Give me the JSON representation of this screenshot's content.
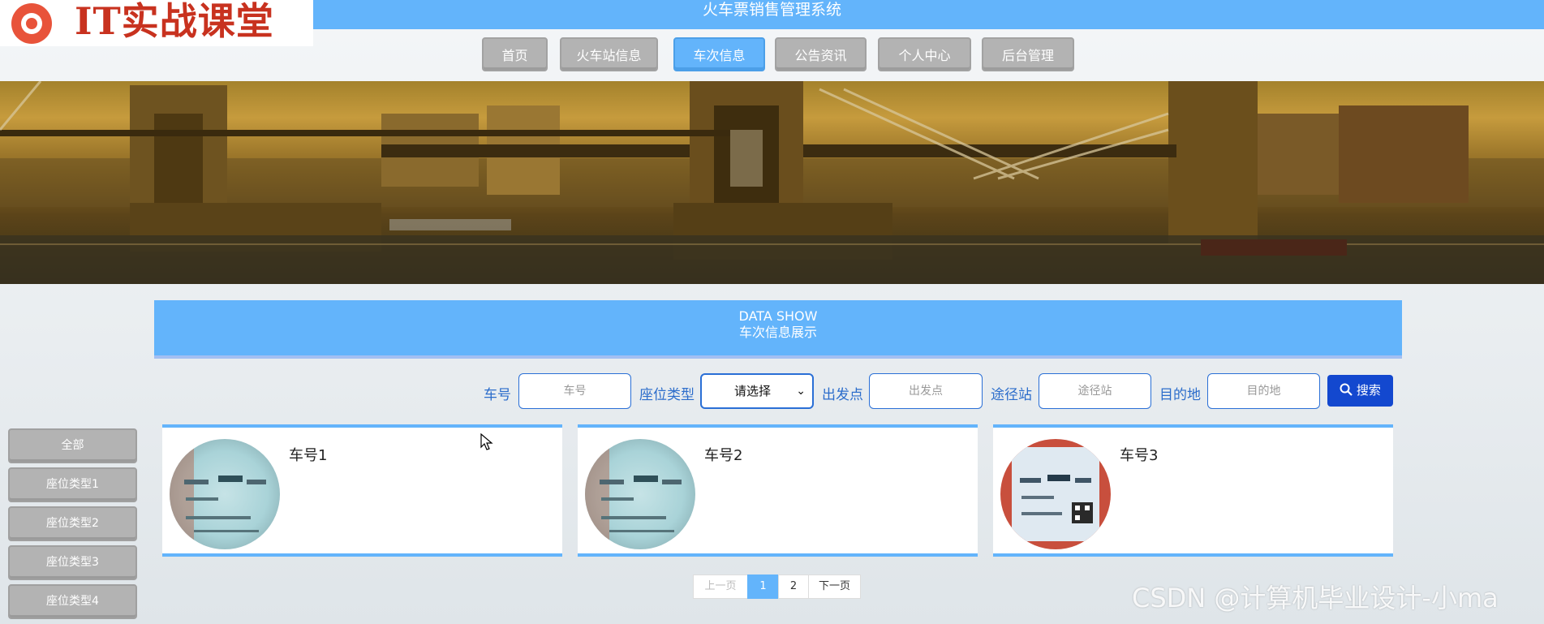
{
  "header": {
    "site_title": "火车票销售管理系统",
    "logo_text": "IT实战课堂",
    "colors": {
      "primary": "#63b4fb",
      "nav_inactive": "#b3b3b3",
      "search_button": "#1348cf",
      "label": "#2c6dcb"
    }
  },
  "nav": {
    "items": [
      {
        "label": "首页"
      },
      {
        "label": "火车站信息"
      },
      {
        "label": "车次信息",
        "active": true
      },
      {
        "label": "公告资讯"
      },
      {
        "label": "个人中心"
      },
      {
        "label": "后台管理"
      }
    ]
  },
  "section": {
    "title_en": "DATA SHOW",
    "title_cn": "车次信息展示"
  },
  "search": {
    "train_no": {
      "label": "车号",
      "placeholder": "车号"
    },
    "seat_type": {
      "label": "座位类型",
      "selected": "请选择"
    },
    "departure": {
      "label": "出发点",
      "placeholder": "出发点"
    },
    "via": {
      "label": "途径站",
      "placeholder": "途径站"
    },
    "destination": {
      "label": "目的地",
      "placeholder": "目的地"
    },
    "button_label": "搜索",
    "button_icon": "search-icon"
  },
  "categories": [
    {
      "label": "全部"
    },
    {
      "label": "座位类型1"
    },
    {
      "label": "座位类型2"
    },
    {
      "label": "座位类型3"
    },
    {
      "label": "座位类型4"
    }
  ],
  "cards": [
    {
      "title": "车号1"
    },
    {
      "title": "车号2"
    },
    {
      "title": "车号3"
    }
  ],
  "pagination": {
    "prev": "上一页",
    "pages": [
      "1",
      "2"
    ],
    "current": "1",
    "next": "下一页"
  },
  "watermark": "CSDN @计算机毕业设计-小ma"
}
